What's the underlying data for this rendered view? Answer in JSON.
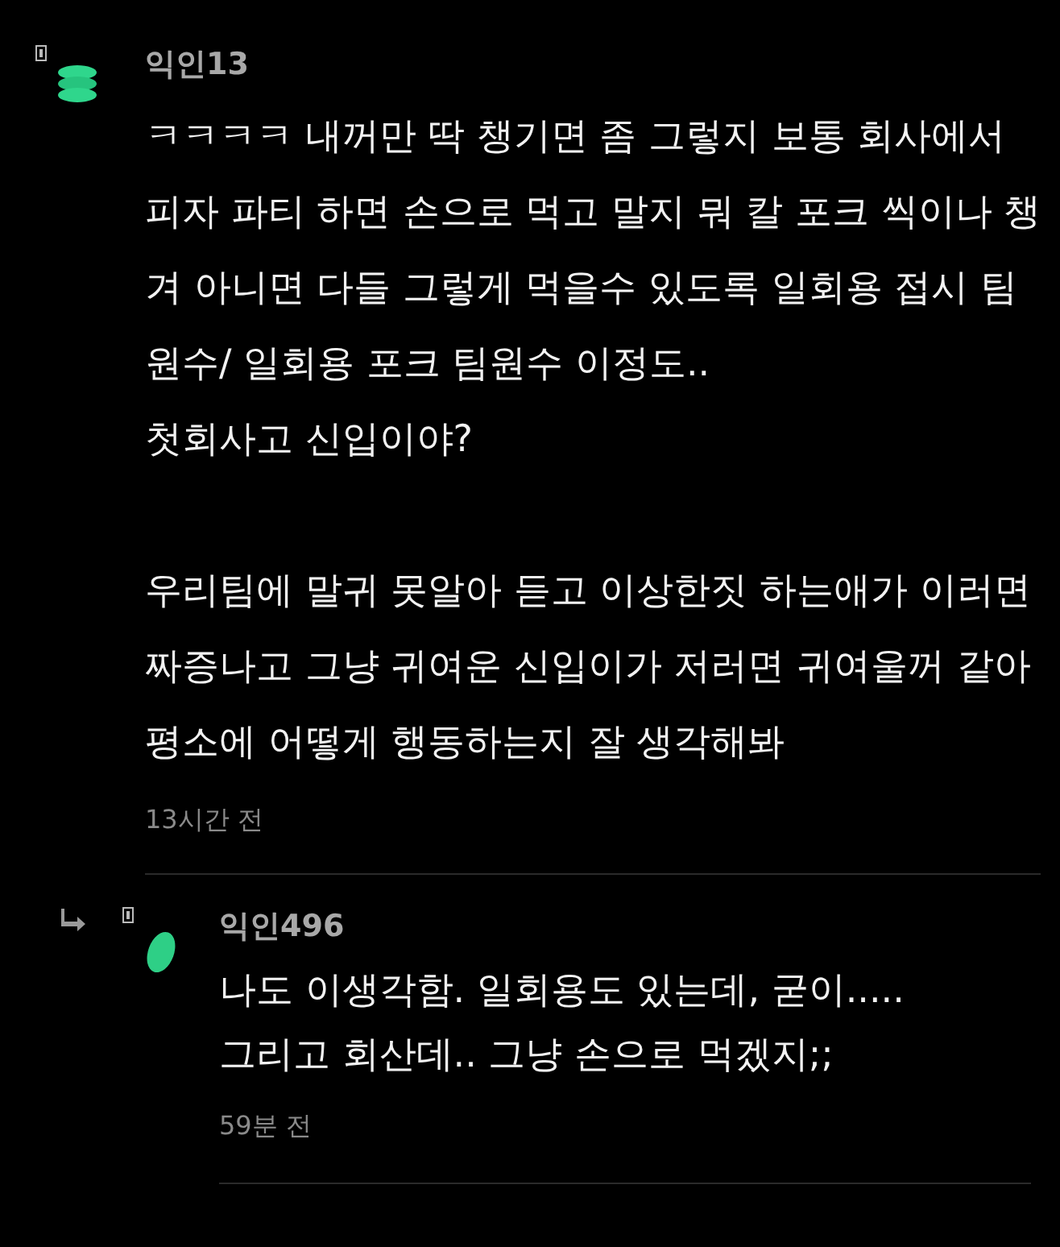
{
  "comments": [
    {
      "kind": "comment",
      "author": "익인13",
      "paragraphs": [
        [
          "ㅋㅋㅋㅋ 내꺼만 딱 챙기면 좀 그렇지 보통 회사에서",
          "피자 파티 하면 손으로 먹고 말지 뭐 칼 포크 씩이나 챙",
          "겨 아니면 다들 그렇게 먹을수 있도록 일회용 접시 팀",
          "원수/ 일회용 포크 팀원수 이정도..",
          "첫회사고 신입이야?"
        ],
        [
          "우리팀에 말귀 못알아 듣고 이상한짓 하는애가 이러면",
          "짜증나고 그냥 귀여운 신입이가 저러면 귀여울꺼 같아",
          "평소에 어떻게 행동하는지 잘 생각해봐"
        ]
      ],
      "time": "13시간 전"
    },
    {
      "kind": "reply",
      "author": "익인496",
      "paragraphs": [
        [
          "나도 이생각함. 일회용도 있는데, 굳이.....",
          "그리고 회산데.. 그냥 손으로 먹겠지;;"
        ]
      ],
      "time": "59분 전"
    }
  ]
}
